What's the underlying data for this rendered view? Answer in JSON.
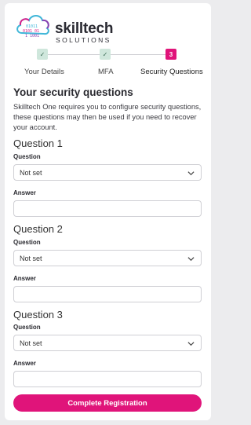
{
  "brand": {
    "name_line1": "skilltech",
    "name_line2": "SOLUTIONS",
    "accent": "#e0147a"
  },
  "stepper": {
    "steps": [
      {
        "label": "Your Details",
        "state": "done",
        "marker": "✓"
      },
      {
        "label": "MFA",
        "state": "done",
        "marker": "✓"
      },
      {
        "label": "Security Questions",
        "state": "active",
        "marker": "3"
      }
    ]
  },
  "section": {
    "title": "Your security questions",
    "intro": "Skilltech One requires you to configure security questions, these questions may then be used if you need to recover your account."
  },
  "questions": [
    {
      "heading": "Question 1",
      "question_label": "Question",
      "selected": "Not set",
      "answer_label": "Answer",
      "answer_value": ""
    },
    {
      "heading": "Question 2",
      "question_label": "Question",
      "selected": "Not set",
      "answer_label": "Answer",
      "answer_value": ""
    },
    {
      "heading": "Question 3",
      "question_label": "Question",
      "selected": "Not set",
      "answer_label": "Answer",
      "answer_value": ""
    }
  ],
  "actions": {
    "submit_label": "Complete Registration"
  }
}
